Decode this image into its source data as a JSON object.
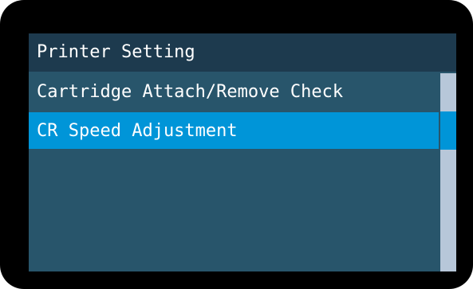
{
  "screen": {
    "title": "Printer Setting"
  },
  "menu": {
    "items": [
      {
        "label": "Cartridge Attach/Remove Check",
        "selected": false
      },
      {
        "label": "CR Speed Adjustment",
        "selected": true
      }
    ],
    "selected_index": 1
  },
  "colors": {
    "bezel": "#000000",
    "screen_background": "#28556b",
    "title_bar": "#1d3a4e",
    "highlight": "#0095d8",
    "scrollbar_track": "#b7c7d9",
    "text": "#ffffff"
  }
}
